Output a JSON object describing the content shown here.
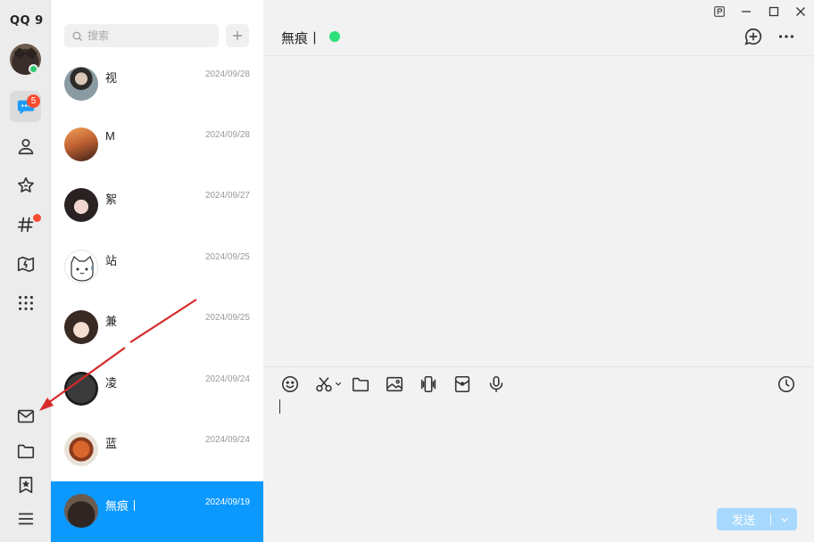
{
  "app": {
    "brand": "QQ 9"
  },
  "rail": {
    "message_badge": "5",
    "items": [
      {
        "icon": "chat-bubble-icon"
      },
      {
        "icon": "contacts-icon"
      },
      {
        "icon": "star-icon"
      },
      {
        "icon": "hashtag-icon"
      },
      {
        "icon": "space-icon"
      },
      {
        "icon": "apps-grid-icon"
      },
      {
        "icon": "mail-icon"
      },
      {
        "icon": "folder-icon"
      },
      {
        "icon": "bookmark-star-icon"
      },
      {
        "icon": "menu-icon"
      }
    ]
  },
  "search": {
    "placeholder": "搜索"
  },
  "conversations": [
    {
      "name": "视",
      "date": "2024/09/28"
    },
    {
      "name": "M",
      "date": "2024/09/28"
    },
    {
      "name": "絮",
      "date": "2024/09/27"
    },
    {
      "name": "站",
      "date": "2024/09/25"
    },
    {
      "name": "兼",
      "date": "2024/09/25"
    },
    {
      "name": "凌",
      "date": "2024/09/24"
    },
    {
      "name": "蓝",
      "date": "2024/09/24"
    },
    {
      "name": "無痕丨",
      "date": "2024/09/19"
    }
  ],
  "chat": {
    "title": "無痕丨",
    "send_label": "发送"
  },
  "colors": {
    "accent": "#0b99ff",
    "online": "#2ee07a",
    "badge": "#f74c30",
    "annotation_arrow": "#d62a2a"
  }
}
